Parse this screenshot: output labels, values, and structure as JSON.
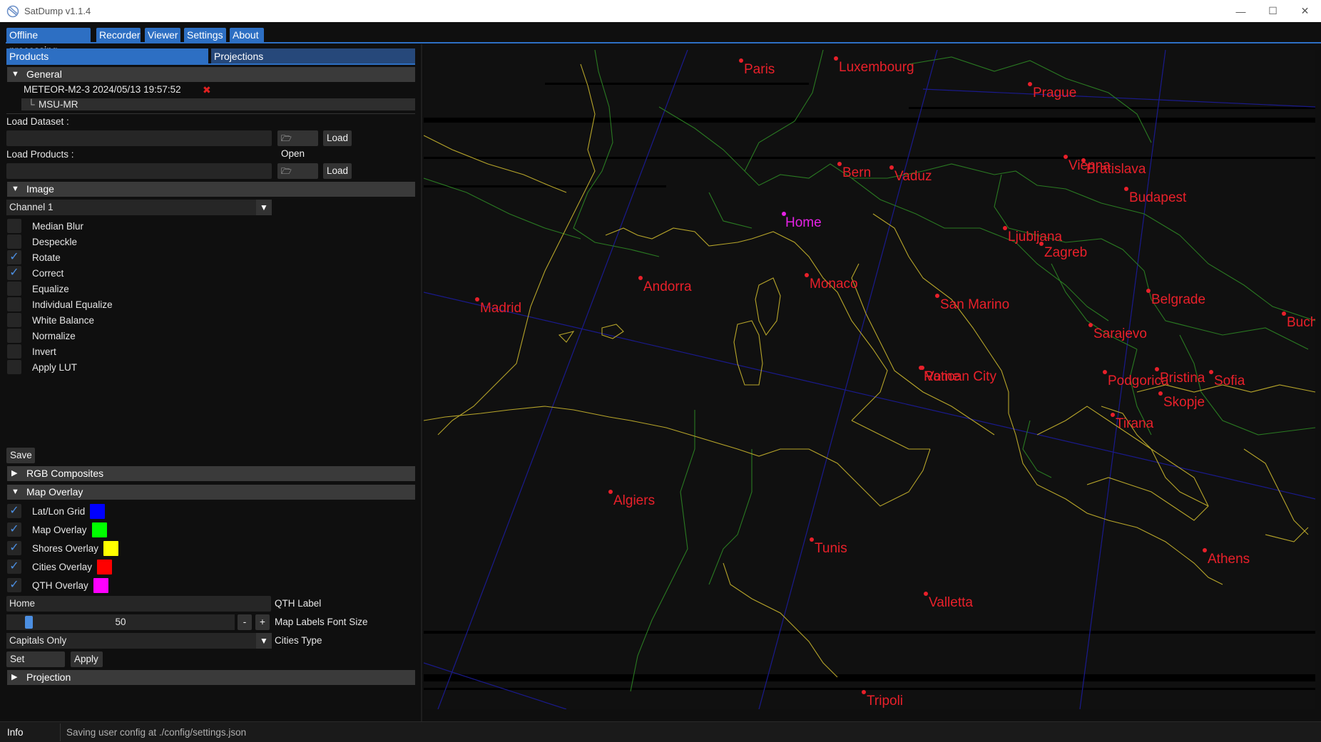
{
  "window": {
    "title": "SatDump v1.1.4",
    "controls": [
      "—",
      "☐",
      "✕"
    ]
  },
  "menu": {
    "tabs": [
      "Offline processing",
      "Recorder",
      "Viewer",
      "Settings",
      "About"
    ],
    "active": "Viewer"
  },
  "subtabs": {
    "products": "Products",
    "projections": "Projections"
  },
  "general": {
    "header": "General",
    "dataset_name": "METEOR-M2-3 2024/05/13 19:57:52",
    "remove_symbol": "✖",
    "product_item": "MSU-MR",
    "tree_prefix": "└",
    "load_dataset_label": "Load Dataset :",
    "load_products_label": "Load Products :",
    "open_label": "Open",
    "load_label": "Load"
  },
  "image": {
    "header": "Image",
    "channel": "Channel 1",
    "options": [
      {
        "label": "Median Blur",
        "checked": false
      },
      {
        "label": "Despeckle",
        "checked": false
      },
      {
        "label": "Rotate",
        "checked": true
      },
      {
        "label": "Correct",
        "checked": true
      },
      {
        "label": "Equalize",
        "checked": false
      },
      {
        "label": "Individual Equalize",
        "checked": false
      },
      {
        "label": "White Balance",
        "checked": false
      },
      {
        "label": "Normalize",
        "checked": false
      },
      {
        "label": "Invert",
        "checked": false
      },
      {
        "label": "Apply LUT",
        "checked": false
      }
    ],
    "save_label": "Save"
  },
  "rgb_composites": {
    "header": "RGB Composites"
  },
  "map_overlay": {
    "header": "Map Overlay",
    "overlays": [
      {
        "label": "Lat/Lon Grid",
        "checked": true,
        "color": "#0000ff"
      },
      {
        "label": "Map Overlay",
        "checked": true,
        "color": "#00ff00"
      },
      {
        "label": "Shores Overlay",
        "checked": true,
        "color": "#ffff00"
      },
      {
        "label": "Cities Overlay",
        "checked": true,
        "color": "#ff0000"
      },
      {
        "label": "QTH Overlay",
        "checked": true,
        "color": "#ff00ff"
      }
    ],
    "qth_value": "Home",
    "qth_label": "QTH Label",
    "font_size_value": "50",
    "font_size_label": "Map Labels Font Size",
    "minus": "-",
    "plus": "+",
    "cities_type_value": "Capitals Only",
    "cities_type_label": "Cities Type",
    "set_defaults_label": "Set Defaults",
    "apply_label": "Apply"
  },
  "projection": {
    "header": "Projection"
  },
  "map": {
    "cities": [
      {
        "name": "Paris"
      },
      {
        "name": "Luxembourg"
      },
      {
        "name": "Prague"
      },
      {
        "name": "Bern"
      },
      {
        "name": "Vaduz"
      },
      {
        "name": "Vienna"
      },
      {
        "name": "Bratislava"
      },
      {
        "name": "Budapest"
      },
      {
        "name": "Ljubljana"
      },
      {
        "name": "Zagreb"
      },
      {
        "name": "Andorra"
      },
      {
        "name": "Monaco"
      },
      {
        "name": "Madrid"
      },
      {
        "name": "San Marino"
      },
      {
        "name": "Belgrade"
      },
      {
        "name": "Buch"
      },
      {
        "name": "Sarajevo"
      },
      {
        "name": "Rome"
      },
      {
        "name": "Vatican City"
      },
      {
        "name": "Podgorica"
      },
      {
        "name": "Pristina"
      },
      {
        "name": "Sofia"
      },
      {
        "name": "Skopje"
      },
      {
        "name": "Tirana"
      },
      {
        "name": "Algiers"
      },
      {
        "name": "Tunis"
      },
      {
        "name": "Athens"
      },
      {
        "name": "Valletta"
      },
      {
        "name": "Tripoli"
      }
    ],
    "qth": {
      "name": "Home"
    }
  },
  "status": {
    "label": "Info",
    "message": "Saving user config at ./config/settings.json"
  }
}
